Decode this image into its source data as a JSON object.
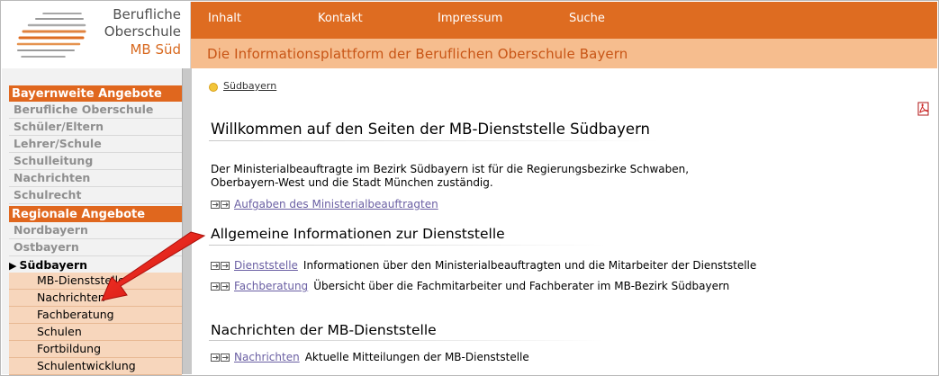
{
  "logo": {
    "line1": "Berufliche",
    "line2": "Oberschule",
    "line3": "MB Süd"
  },
  "topnav": [
    "Inhalt",
    "Kontakt",
    "Impressum",
    "Suche"
  ],
  "tagline": "Die Informationsplattform der Beruflichen Oberschule Bayern",
  "sidebar": {
    "section1": "Bayernweite Angebote",
    "items1": [
      "Berufliche Oberschule",
      "Schüler/Eltern",
      "Lehrer/Schule",
      "Schulleitung",
      "Nachrichten",
      "Schulrecht"
    ],
    "section2": "Regionale Angebote",
    "items2": [
      "Nordbayern",
      "Ostbayern"
    ],
    "current": "Südbayern",
    "subitems": [
      "MB-Dienststelle",
      "Nachrichten",
      "Fachberatung",
      "Schulen",
      "Fortbildung",
      "Schulentwicklung"
    ]
  },
  "breadcrumb": "Südbayern",
  "content": {
    "title": "Willkommen auf den Seiten der MB-Dienststelle Südbayern",
    "intro_line1": "Der Ministerialbeauftragte im Bezirk Südbayern ist für die Regierungsbezirke Schwaben,",
    "intro_line2": "Oberbayern-West und die Stadt München zuständig.",
    "link_aufgaben": "Aufgaben des Ministerialbeauftragten",
    "section_allgemein": "Allgemeine Informationen zur Dienststelle",
    "link_dienststelle": "Dienststelle",
    "desc_dienststelle": "Informationen über den Ministerialbeauftragten und die Mitarbeiter der Dienststelle",
    "link_fachberatung": "Fachberatung",
    "desc_fachberatung": "Übersicht über die Fachmitarbeiter und Fachberater im MB-Bezirk Südbayern",
    "section_nachrichten": "Nachrichten der MB-Dienststelle",
    "link_nachrichten": "Nachrichten",
    "desc_nachrichten": "Aktuelle Mitteilungen der MB-Dienststelle"
  },
  "icons": {
    "pdf": "pdf-icon",
    "link": "link-arrow-icon",
    "breadcrumb": "bullet-dot-icon",
    "current": "triangle-right-icon",
    "annotation": "red-arrow-icon"
  },
  "colors": {
    "brand_orange": "#de6c21",
    "tagline_bg": "#f6bd8e",
    "tagline_text": "#c85516",
    "submenu_bg": "#f7d6bc",
    "link": "#6a5fa3",
    "annotation": "#e3231c"
  }
}
